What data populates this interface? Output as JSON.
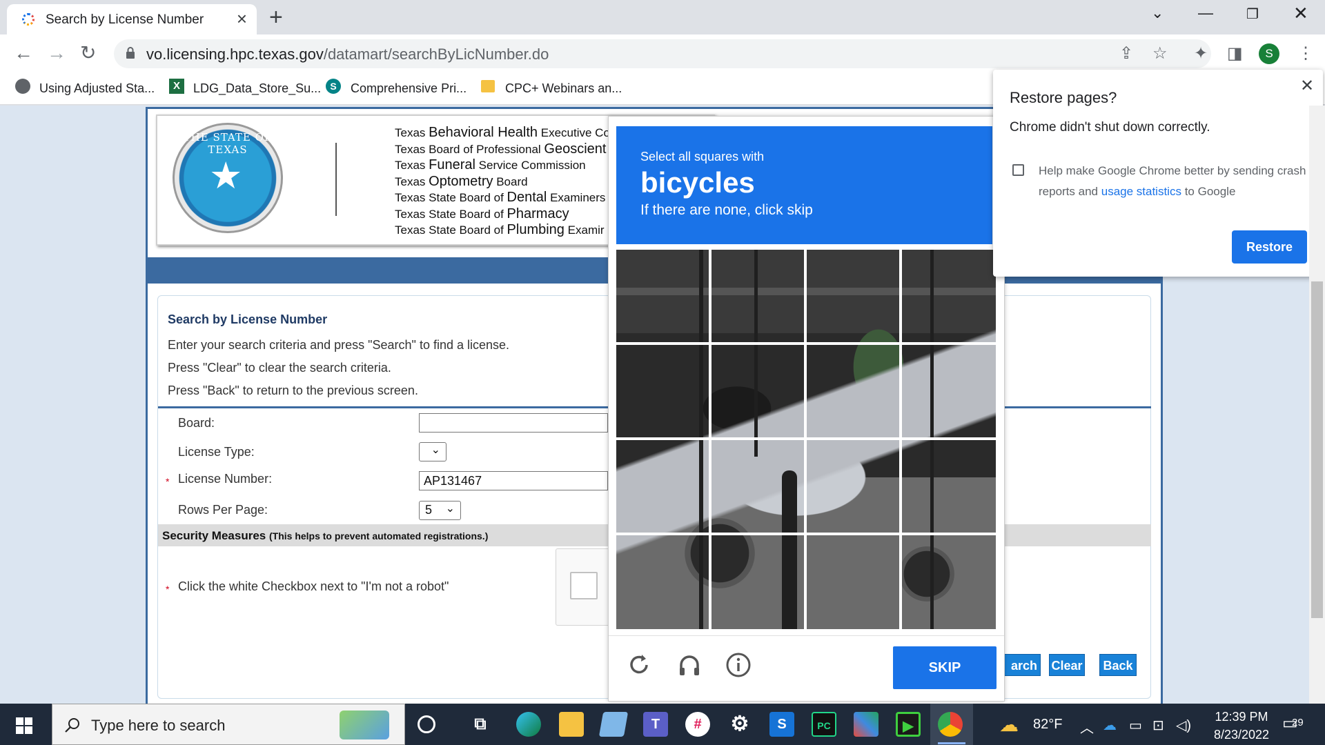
{
  "browser": {
    "tab_title": "Search by License Number",
    "url_host": "vo.licensing.hpc.texas.gov",
    "url_path": "/datamart/searchByLicNumber.do",
    "profile_initial": "S",
    "bookmarks": [
      {
        "label": "Using Adjusted Sta...",
        "icon": "globe-icon"
      },
      {
        "label": "LDG_Data_Store_Su...",
        "icon": "excel-icon"
      },
      {
        "label": "Comprehensive Pri...",
        "icon": "sharepoint-icon"
      },
      {
        "label": "CPC+ Webinars an...",
        "icon": "folder-icon"
      }
    ]
  },
  "header": {
    "seal_text": "THE STATE OF TEXAS",
    "agencies": [
      {
        "pre": "Texas ",
        "big": "Behavioral Health",
        "post": " Executive Co"
      },
      {
        "pre": "Texas Board of Professional ",
        "big": "Geoscient",
        "post": ""
      },
      {
        "pre": "Texas ",
        "big": "Funeral",
        "post": " Service Commission"
      },
      {
        "pre": "Texas ",
        "big": "Optometry",
        "post": " Board"
      },
      {
        "pre": "Texas State Board of ",
        "big": "Dental",
        "post": " Examiners"
      },
      {
        "pre": "Texas State Board of ",
        "big": "Pharmacy",
        "post": ""
      },
      {
        "pre": "Texas State Board of ",
        "big": "Plumbing",
        "post": " Examir"
      }
    ]
  },
  "search": {
    "title": "Search by License Number",
    "line1": "Enter your search criteria and press \"Search\" to find a license.",
    "line2": "Press \"Clear\" to clear the search criteria.",
    "line3": "Press \"Back\" to return to the previous screen.",
    "board_label": "Board:",
    "board_value": "",
    "license_type_label": "License Type:",
    "license_number_label": "License Number:",
    "license_number_value": "AP131467",
    "rows_label": "Rows Per Page:",
    "rows_value": "5",
    "required_mark": "*",
    "security_title": "Security Measures",
    "security_note": "(This helps to prevent automated registrations.)",
    "robot_instruction": "Click the white Checkbox next to \"I'm not a robot\"",
    "search_btn": "arch",
    "clear_btn": "Clear",
    "back_btn": "Back"
  },
  "captcha": {
    "prompt_small": "Select all squares with",
    "prompt_big": "bicycles",
    "prompt_sub": "If there are none, click skip",
    "skip_label": "SKIP"
  },
  "restore_popup": {
    "title": "Restore pages?",
    "message": "Chrome didn't shut down correctly.",
    "help_pre": "Help make Google Chrome better by sending crash reports and ",
    "help_link": "usage statistics",
    "help_post": " to Google",
    "button": "Restore"
  },
  "taskbar": {
    "search_placeholder": "Type here to search",
    "weather": "82°F",
    "time": "12:39 PM",
    "date": "8/23/2022",
    "notifications": "29"
  }
}
